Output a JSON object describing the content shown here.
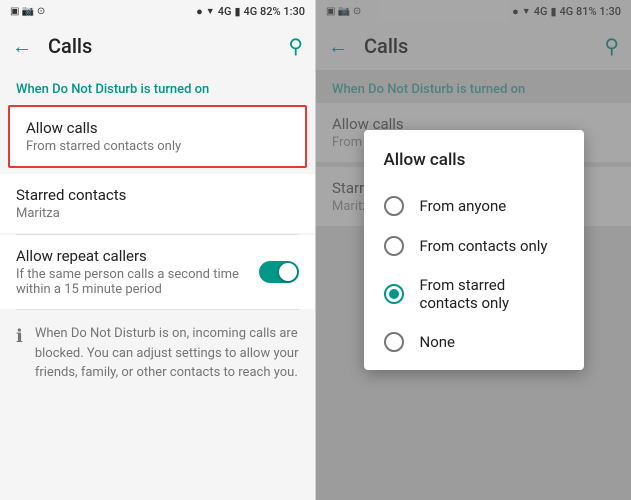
{
  "left_panel": {
    "status_bar": {
      "left_icons": "📱 📷 ⊙",
      "right_text": "4G  82%  1:30"
    },
    "toolbar": {
      "title": "Calls",
      "back_icon": "←",
      "search_icon": "🔍"
    },
    "section_header": "When Do Not Disturb is turned on",
    "allow_calls": {
      "title": "Allow calls",
      "subtitle": "From starred contacts only",
      "highlighted": true
    },
    "starred_contacts": {
      "title": "Starred contacts",
      "subtitle": "Maritza"
    },
    "allow_repeat": {
      "title": "Allow repeat callers",
      "subtitle": "If the same person calls a second time within a 15 minute period",
      "toggle_on": true
    },
    "info_text": "When Do Not Disturb is on, incoming calls are blocked. You can adjust settings to allow your friends, family, or other contacts to reach you."
  },
  "right_panel": {
    "status_bar": {
      "right_text": "4G  81%  1:30"
    },
    "toolbar": {
      "title": "Calls",
      "back_icon": "←",
      "search_icon": "🔍"
    },
    "section_header": "When Do Not Disturb is turned on",
    "allow_calls": {
      "title": "Allow calls",
      "subtitle": "From starred contacts only"
    },
    "starred_contacts": {
      "title": "Starred contacts",
      "subtitle": "Maritza"
    }
  },
  "dialog": {
    "title": "Allow calls",
    "options": [
      {
        "label": "From anyone",
        "selected": false
      },
      {
        "label": "From contacts only",
        "selected": false
      },
      {
        "label": "From starred contacts only",
        "selected": true
      },
      {
        "label": "None",
        "selected": false
      }
    ]
  },
  "colors": {
    "teal": "#009688",
    "red": "#e53935"
  }
}
